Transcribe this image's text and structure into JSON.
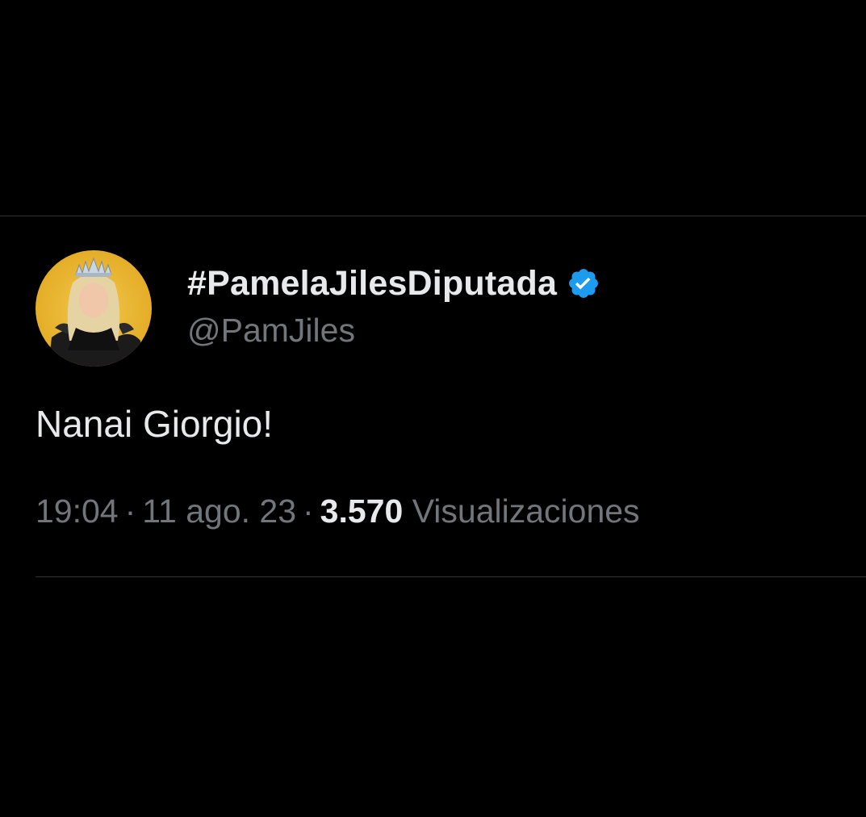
{
  "tweet": {
    "author": {
      "display_name": "#PamelaJilesDiputada",
      "handle": "@PamJiles",
      "verified": true,
      "avatar_icon": "profile-photo"
    },
    "text": "Nanai Giorgio!",
    "meta": {
      "time": "19:04",
      "separator": "·",
      "date": "11 ago. 23",
      "views_count": "3.570",
      "views_label": "Visualizaciones"
    }
  },
  "colors": {
    "background": "#000000",
    "primary_text": "#e7e9ea",
    "secondary_text": "#71767b",
    "divider": "#2f3336",
    "verified_blue": "#1d9bf0",
    "avatar_bg": "#e8b531"
  }
}
